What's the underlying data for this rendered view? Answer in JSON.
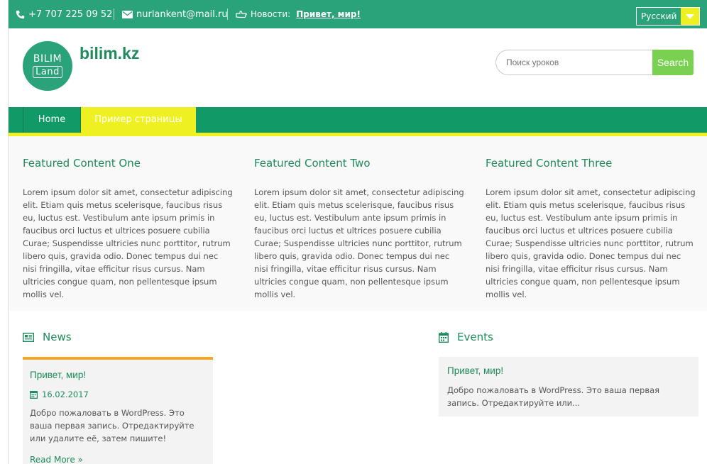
{
  "topbar": {
    "phone": "+7 707 225 09 52",
    "email": "nurlankent@mail.ru",
    "news_label": "Новости:",
    "news_link": "Привет, мир!",
    "language": "Русский"
  },
  "header": {
    "logo_line1": "BILIM",
    "logo_line2": "Land",
    "site_title": "bilim.kz",
    "search_placeholder": "Поиск уроков",
    "search_button": "Search"
  },
  "nav": {
    "items": [
      {
        "label": "Home"
      },
      {
        "label": "Пример страницы"
      }
    ]
  },
  "featured": [
    {
      "title": "Featured Content One",
      "text": "Lorem ipsum dolor sit amet, consectetur adipiscing elit. Etiam quis metus scelerisque, faucibus risus eu, luctus est. Vestibulum ante ipsum primis in faucibus orci luctus et ultrices posuere cubilia Curae; Suspendisse ultricies nunc porttitor, rutrum libero quis, gravida odio. Donec tempus dui nec nisi fringilla, vitae efficitur risus cursus. Nam ultricies congue quam, non pellentesque ipsum mollis vel."
    },
    {
      "title": "Featured Content Two",
      "text": "Lorem ipsum dolor sit amet, consectetur adipiscing elit. Etiam quis metus scelerisque, faucibus risus eu, luctus est. Vestibulum ante ipsum primis in faucibus orci luctus et ultrices posuere cubilia Curae; Suspendisse ultricies nunc porttitor, rutrum libero quis, gravida odio. Donec tempus dui nec nisi fringilla, vitae efficitur risus cursus. Nam ultricies congue quam, non pellentesque ipsum mollis vel."
    },
    {
      "title": "Featured Content Three",
      "text": "Lorem ipsum dolor sit amet, consectetur adipiscing elit. Etiam quis metus scelerisque, faucibus risus eu, luctus est. Vestibulum ante ipsum primis in faucibus orci luctus et ultrices posuere cubilia Curae; Suspendisse ultricies nunc porttitor, rutrum libero quis, gravida odio. Donec tempus dui nec nisi fringilla, vitae efficitur risus cursus. Nam ultricies congue quam, non pellentesque ipsum mollis vel."
    }
  ],
  "news": {
    "heading": "News",
    "post": {
      "title": "Привет, мир!",
      "date": "16.02.2017",
      "excerpt": "Добро пожаловать в WordPress. Это ваша первая запись. Отредактируйте или удалите её, затем пишите!",
      "read_more": "Read More »"
    }
  },
  "events": {
    "heading": "Events",
    "post": {
      "title": "Привет, мир!",
      "excerpt": "Добро пожаловать в WordPress. Это ваша первая запись. Отредактируйте или..."
    }
  },
  "icons": {
    "phone": "phone-icon",
    "mail": "envelope-icon",
    "news": "hand-pointer-icon",
    "news_section": "newspaper-icon",
    "calendar": "calendar-icon",
    "lang": "chevron-down-icon"
  },
  "colors": {
    "primary": "#2aa37a",
    "nav": "#129968",
    "accent_yellow": "#eef021",
    "accent_orange": "#f5a623",
    "search_green": "#7ad050",
    "title_green": "#1e8b5a"
  }
}
